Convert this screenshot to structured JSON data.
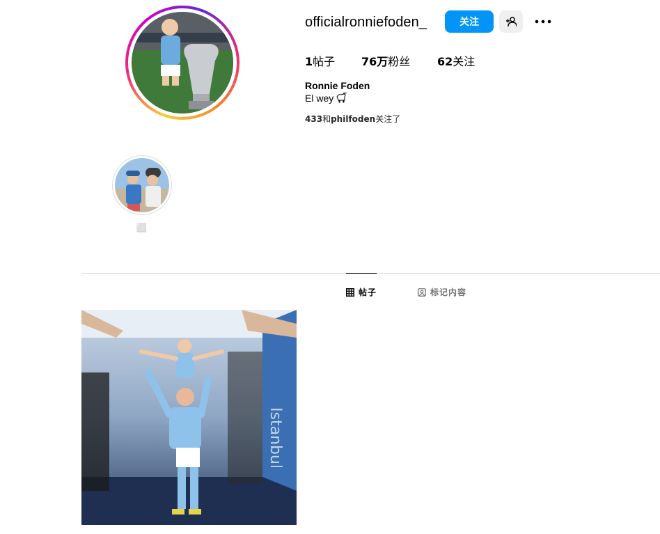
{
  "profile": {
    "username": "officialronniefoden_",
    "follow_label": "关注",
    "full_name": "Ronnie Foden",
    "bio_text": "El wey",
    "bio_icon": "goat-emoji-icon"
  },
  "stats": {
    "posts_count": "1",
    "posts_label": "帖子",
    "followers_count": "76万",
    "followers_label": "粉丝",
    "following_count": "62",
    "following_label": "关注"
  },
  "followed_by": {
    "account1": "433",
    "joiner": "和",
    "account2": "philfoden",
    "suffix": "关注了"
  },
  "highlights": [
    {
      "label": "⬜",
      "icon": "story-highlight-thumbnail"
    }
  ],
  "tabs": [
    {
      "label": "帖子",
      "icon": "grid-icon",
      "active": true
    },
    {
      "label": "标记内容",
      "icon": "tagged-icon",
      "active": false
    }
  ],
  "colors": {
    "accent": "#0095f6",
    "secondary_button": "#efefef",
    "divider": "#dbdbdb",
    "muted_text": "#737373"
  }
}
